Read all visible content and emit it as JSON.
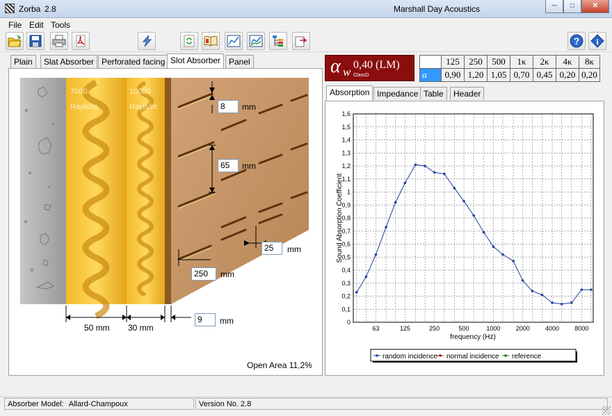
{
  "window": {
    "app": "Zorba",
    "version": "2.8",
    "company": "Marshall Day Acoustics"
  },
  "menu": [
    "File",
    "Edit",
    "Tools"
  ],
  "tabs": [
    "Plain",
    "Slat Absorber",
    "Perforated facing",
    "Slot Absorber",
    "Panel"
  ],
  "active_tab": "Slot Absorber",
  "diagram": {
    "layer1_resistivity": "7000",
    "layer1_unit": "Rayls/m",
    "layer2_resistivity": "10000",
    "layer2_unit": "Rayls/m",
    "slot_width_value": "8",
    "slot_spacing_value": "65",
    "facing_thickness_value": "25",
    "slot_length_value": "250",
    "air_gap_value": "9",
    "mm": "mm",
    "layer1_thickness": "50 mm",
    "layer2_thickness": "30 mm",
    "open_area": "Open Area 11,2%"
  },
  "rating": {
    "alpha": "α",
    "w": "w",
    "value": "0,40 (LM)",
    "class": "ClassD"
  },
  "alpha_table": {
    "header": [
      "125",
      "250",
      "500",
      "1κ",
      "2κ",
      "4κ",
      "8κ"
    ],
    "row_label": "α",
    "values": [
      "0,90",
      "1,20",
      "1,05",
      "0,70",
      "0,45",
      "0,20",
      "0,20"
    ]
  },
  "right_tabs": [
    "Absorption",
    "Impedance",
    "Table",
    "Header"
  ],
  "active_right_tab": "Absorption",
  "chart_data": {
    "type": "line",
    "xlabel": "frequency (Hz)",
    "ylabel": "Sound Absorption Coefficient",
    "x_scale": "log",
    "xticks": [
      "63",
      "125",
      "250",
      "500",
      "1000",
      "2000",
      "4000",
      "8000"
    ],
    "yticks": [
      "0",
      "0,1",
      "0,2",
      "0,3",
      "0,4",
      "0,5",
      "0,6",
      "0,7",
      "0,8",
      "0,9",
      "1",
      "1,1",
      "1,2",
      "1,3",
      "1,4",
      "1,5",
      "1,6"
    ],
    "ylim": [
      0,
      1.6
    ],
    "grid": true,
    "legend_position": "bottom",
    "series": [
      {
        "name": "random incidence",
        "color": "#1f3fa0",
        "x": [
          40,
          50,
          63,
          80,
          100,
          125,
          160,
          200,
          250,
          315,
          400,
          500,
          630,
          800,
          1000,
          1250,
          1600,
          2000,
          2500,
          3150,
          4000,
          5000,
          6300,
          8000,
          10000
        ],
        "y": [
          0.23,
          0.35,
          0.52,
          0.73,
          0.92,
          1.07,
          1.21,
          1.2,
          1.15,
          1.14,
          1.03,
          0.93,
          0.82,
          0.69,
          0.58,
          0.52,
          0.47,
          0.32,
          0.24,
          0.21,
          0.15,
          0.14,
          0.15,
          0.25,
          0.25
        ]
      },
      {
        "name": "normal incidence",
        "color": "#a01010",
        "x": [],
        "y": []
      },
      {
        "name": "reference",
        "color": "#107010",
        "x": [],
        "y": []
      }
    ]
  },
  "status": {
    "model_label": "Absorber Model:",
    "model": "Allard-Champoux",
    "version": "Version No. 2.8"
  },
  "icons": [
    "open-folder-icon",
    "save-icon",
    "print-icon",
    "pdf-icon",
    "calculate-icon",
    "refresh-icon",
    "book-icon",
    "chart-icon",
    "chart-compare-icon",
    "tree-icon",
    "export-icon",
    "help-icon",
    "info-icon"
  ]
}
